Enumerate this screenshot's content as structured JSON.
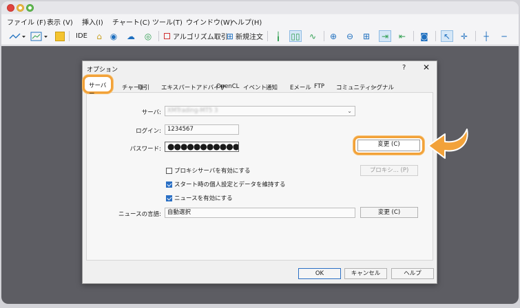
{
  "menu": {
    "items": [
      "ファイル (F)",
      "表示 (V)",
      "挿入(I)",
      "チャート(C)",
      "ツール(T)",
      "ウインドウ(W)",
      "ヘルプ(H)"
    ]
  },
  "toolbar": {
    "ide_label": "IDE",
    "algo_label": "アルゴリズム取引",
    "new_order_label": "新規注文"
  },
  "dialog": {
    "title": "オプション",
    "help": "?",
    "close": "✕",
    "tabs": [
      "サーバー",
      "チャート",
      "取引",
      "エキスパートアドバイザ",
      "OpenCL",
      "イベント",
      "通知",
      "Eメール",
      "FTP",
      "コミュニティー",
      "シグナル"
    ],
    "server_label": "サーバ:",
    "server_value": "XMTrading-MT5 3",
    "login_label": "ログイン:",
    "login_value": "1234567",
    "password_label": "パスワード:",
    "password_value": "●●●●●●●●●●●●●",
    "change_button": "変更 (C)",
    "proxy_button": "プロキシ... (P)",
    "proxy_checkbox": "プロキシサーバを有効にする",
    "startup_checkbox": "スタート時の個人設定とデータを維持する",
    "news_checkbox": "ニュースを有効にする",
    "news_lang_label": "ニュースの言語:",
    "news_lang_value": "自動選択",
    "news_change_button": "変更 (C)",
    "ok_button": "OK",
    "cancel_button": "キャンセル",
    "help_button": "ヘルプ"
  }
}
